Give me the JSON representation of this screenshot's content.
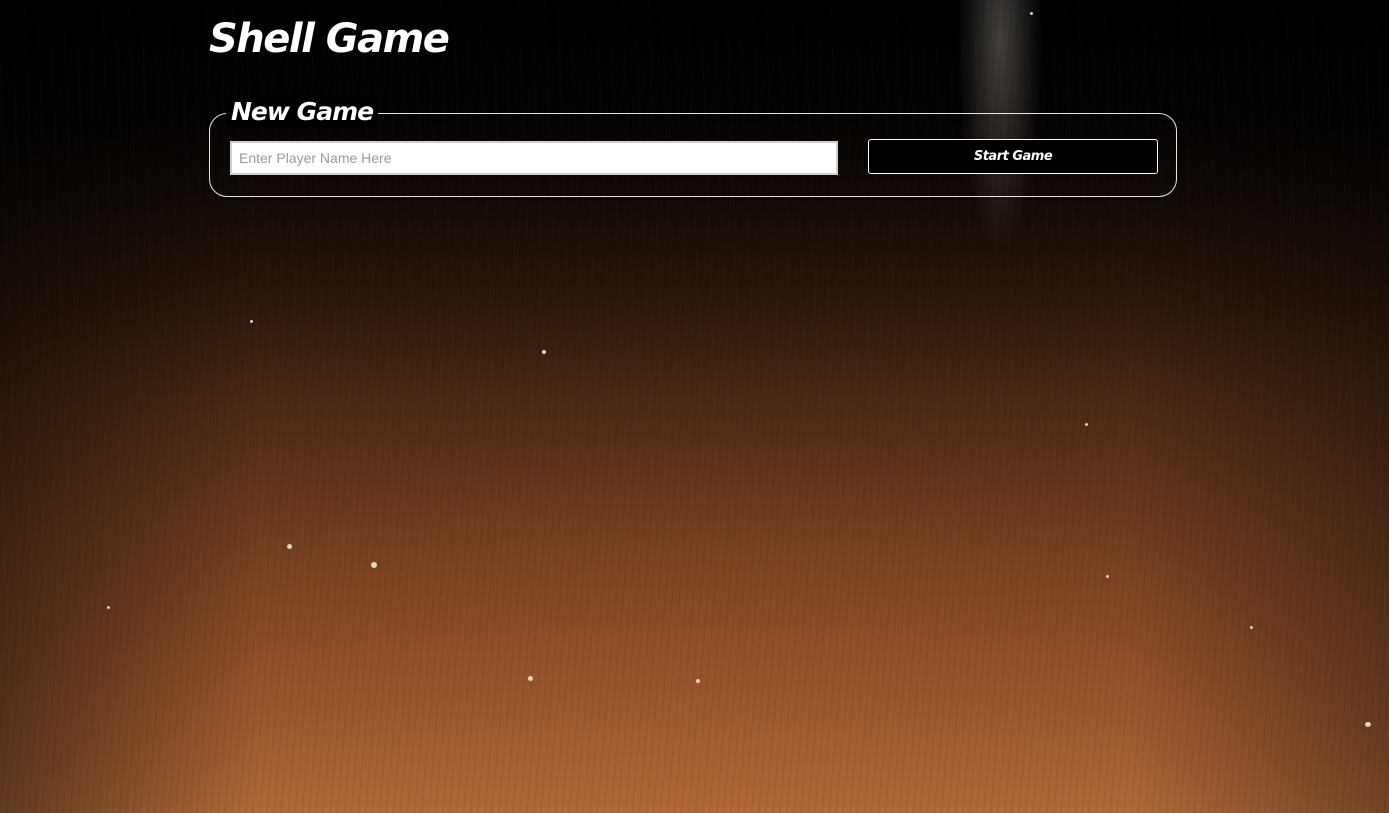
{
  "header": {
    "title": "Shell Game"
  },
  "new_game": {
    "legend": "New Game",
    "player_name": {
      "value": "",
      "placeholder": "Enter Player Name Here"
    },
    "start_label": "Start Game"
  },
  "colors": {
    "text": "#ffffff",
    "panel_border": "#e6e6e6",
    "button_background": "#000000",
    "input_background": "#ffffff",
    "placeholder": "#9a9a9a"
  },
  "background": {
    "description_icon": "wood-table-background"
  }
}
